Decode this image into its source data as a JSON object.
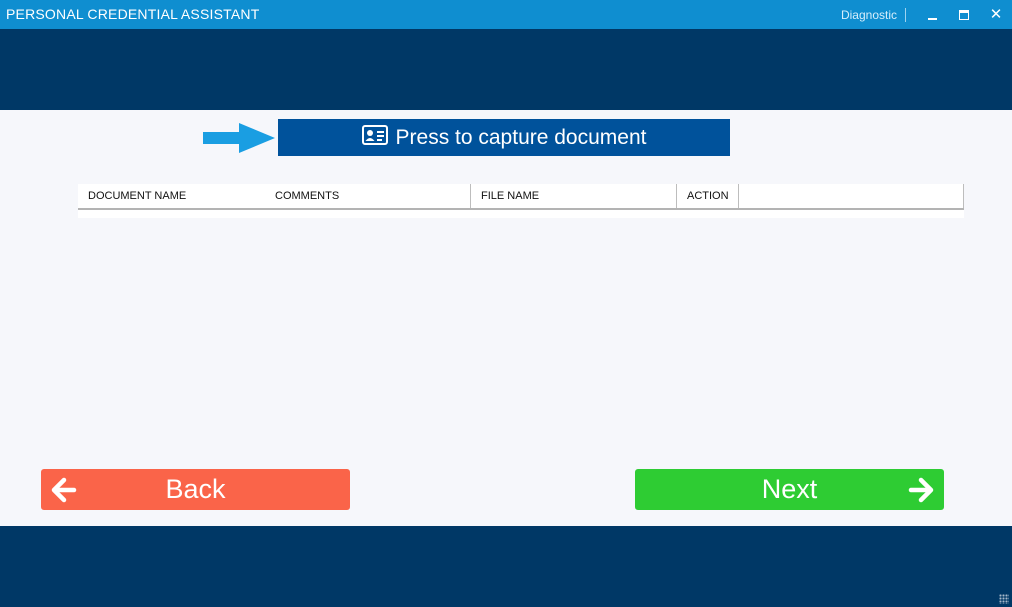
{
  "window": {
    "title": "PERSONAL CREDENTIAL ASSISTANT",
    "diagnostic_label": "Diagnostic",
    "controls": [
      "minimize",
      "maximize",
      "close"
    ]
  },
  "capture": {
    "button_label": "Press to capture document",
    "button_icon": "id-card-icon",
    "indicator_icon": "arrow-right-icon"
  },
  "table": {
    "columns": [
      "DOCUMENT NAME",
      "COMMENTS",
      "FILE NAME",
      "ACTION"
    ],
    "rows": []
  },
  "navigation": {
    "back_label": "Back",
    "next_label": "Next"
  },
  "colors": {
    "titlebar": "#0f8ed0",
    "band": "#003866",
    "capture_button": "#00529b",
    "back_button": "#fa6449",
    "next_button": "#2ecc33",
    "indicator_arrow": "#1a9ee2"
  }
}
